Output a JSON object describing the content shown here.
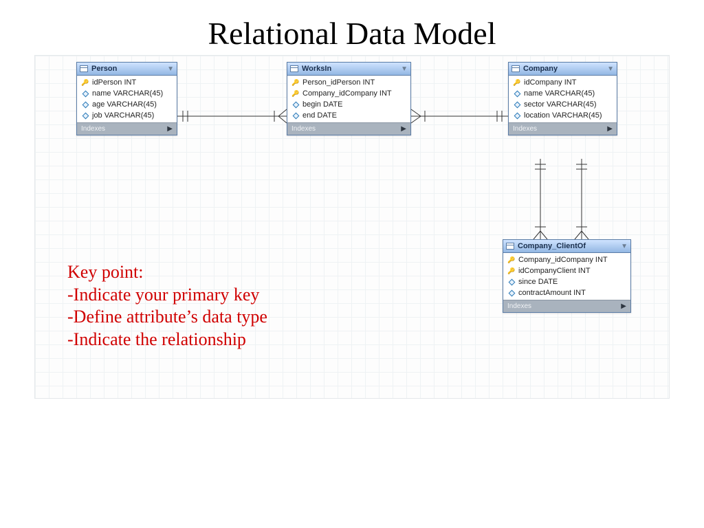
{
  "title": "Relational Data Model",
  "indexes_label": "Indexes",
  "entities": {
    "person": {
      "name": "Person",
      "attrs": [
        {
          "icon": "key",
          "text": "idPerson INT"
        },
        {
          "icon": "diamond",
          "text": "name VARCHAR(45)"
        },
        {
          "icon": "diamond",
          "text": "age VARCHAR(45)"
        },
        {
          "icon": "diamond",
          "text": "job VARCHAR(45)"
        }
      ]
    },
    "worksin": {
      "name": "WorksIn",
      "attrs": [
        {
          "icon": "key",
          "text": "Person_idPerson INT"
        },
        {
          "icon": "key",
          "text": "Company_idCompany INT"
        },
        {
          "icon": "diamond",
          "text": "begin DATE"
        },
        {
          "icon": "diamond",
          "text": "end DATE"
        }
      ]
    },
    "company": {
      "name": "Company",
      "attrs": [
        {
          "icon": "key",
          "text": "idCompany INT"
        },
        {
          "icon": "diamond",
          "text": "name VARCHAR(45)"
        },
        {
          "icon": "diamond",
          "text": "sector VARCHAR(45)"
        },
        {
          "icon": "diamond",
          "text": "location VARCHAR(45)"
        }
      ]
    },
    "clientof": {
      "name": "Company_ClientOf",
      "attrs": [
        {
          "icon": "key",
          "text": "Company_idCompany INT"
        },
        {
          "icon": "key",
          "text": "idCompanyClient INT"
        },
        {
          "icon": "diamond",
          "text": "since DATE"
        },
        {
          "icon": "diamond",
          "text": "contractAmount INT"
        }
      ]
    }
  },
  "keypoint": {
    "heading": "Key point:",
    "bullets": [
      "Indicate your primary key",
      "Define attribute’s data type",
      "Indicate the relationship"
    ]
  }
}
